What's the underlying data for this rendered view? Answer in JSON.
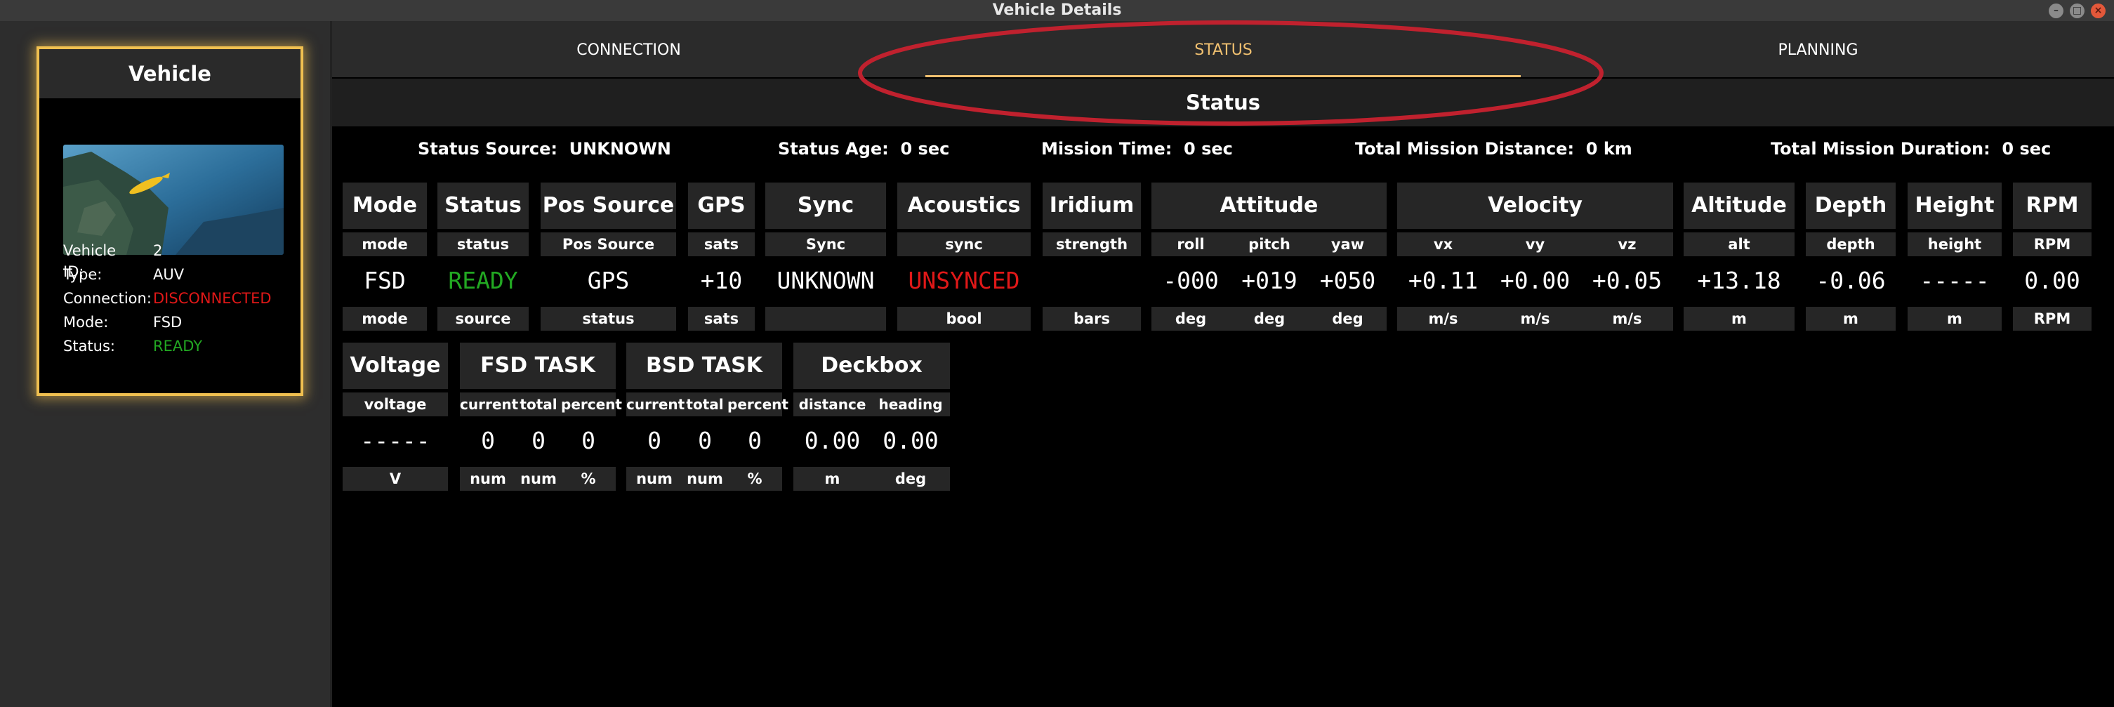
{
  "window": {
    "title": "Vehicle Details"
  },
  "vehicle_card": {
    "title": "Vehicle",
    "fields": [
      {
        "label": "Vehicle ID:",
        "value": "2"
      },
      {
        "label": "Type:",
        "value": "AUV"
      },
      {
        "label": "Connection:",
        "value": "DISCONNECTED"
      },
      {
        "label": "Mode:",
        "value": "FSD"
      },
      {
        "label": "Status:",
        "value": "READY"
      }
    ]
  },
  "tabs": [
    {
      "label": "CONNECTION"
    },
    {
      "label": "STATUS",
      "selected": true
    },
    {
      "label": "PLANNING"
    }
  ],
  "section_title": "Status",
  "info": {
    "status_source": {
      "label": "Status Source:",
      "value": "UNKNOWN"
    },
    "status_age": {
      "label": "Status Age:",
      "value": "0 sec"
    },
    "mission_time": {
      "label": "Mission Time:",
      "value": "0 sec"
    },
    "total_distance": {
      "label": "Total Mission Distance:",
      "value": "0 km"
    },
    "total_duration": {
      "label": "Total Mission Duration:",
      "value": "0 sec"
    }
  },
  "groups_row1": [
    {
      "title": "Mode",
      "cols": [
        {
          "label": "mode",
          "value": "FSD",
          "unit": "mode"
        }
      ]
    },
    {
      "title": "Status",
      "cols": [
        {
          "label": "status",
          "value": "READY",
          "unit": "source"
        }
      ]
    },
    {
      "title": "Pos Source",
      "cols": [
        {
          "label": "Pos Source",
          "value": "GPS",
          "unit": "status"
        }
      ]
    },
    {
      "title": "GPS",
      "cols": [
        {
          "label": "sats",
          "value": "+10",
          "unit": "sats"
        }
      ]
    },
    {
      "title": "Sync",
      "cols": [
        {
          "label": "Sync",
          "value": "UNKNOWN",
          "unit": ""
        }
      ]
    },
    {
      "title": "Acoustics",
      "cols": [
        {
          "label": "sync",
          "value": "UNSYNCED",
          "unit": "bool"
        }
      ]
    },
    {
      "title": "Iridium",
      "cols": [
        {
          "label": "strength",
          "value": "",
          "unit": "bars"
        }
      ]
    },
    {
      "title": "Attitude",
      "cols": [
        {
          "label": "roll",
          "value": "-000",
          "unit": "deg"
        },
        {
          "label": "pitch",
          "value": "+019",
          "unit": "deg"
        },
        {
          "label": "yaw",
          "value": "+050",
          "unit": "deg"
        }
      ]
    },
    {
      "title": "Velocity",
      "cols": [
        {
          "label": "vx",
          "value": "+0.11",
          "unit": "m/s"
        },
        {
          "label": "vy",
          "value": "+0.00",
          "unit": "m/s"
        },
        {
          "label": "vz",
          "value": "+0.05",
          "unit": "m/s"
        }
      ]
    },
    {
      "title": "Altitude",
      "cols": [
        {
          "label": "alt",
          "value": "+13.18",
          "unit": "m"
        }
      ]
    },
    {
      "title": "Depth",
      "cols": [
        {
          "label": "depth",
          "value": "-0.06",
          "unit": "m"
        }
      ]
    },
    {
      "title": "Height",
      "cols": [
        {
          "label": "height",
          "value": "-----",
          "unit": "m"
        }
      ]
    },
    {
      "title": "RPM",
      "cols": [
        {
          "label": "RPM",
          "value": "0.00",
          "unit": "RPM"
        }
      ]
    }
  ],
  "groups_row2": [
    {
      "title": "Voltage",
      "cols": [
        {
          "label": "voltage",
          "value": "-----",
          "unit": "V"
        }
      ]
    },
    {
      "title": "FSD TASK",
      "cols": [
        {
          "label": "current",
          "value": "0",
          "unit": "num"
        },
        {
          "label": "total",
          "value": "0",
          "unit": "num"
        },
        {
          "label": "percent",
          "value": "0",
          "unit": "%"
        }
      ]
    },
    {
      "title": "BSD TASK",
      "cols": [
        {
          "label": "current",
          "value": "0",
          "unit": "num"
        },
        {
          "label": "total",
          "value": "0",
          "unit": "num"
        },
        {
          "label": "percent",
          "value": "0",
          "unit": "%"
        }
      ]
    },
    {
      "title": "Deckbox",
      "cols": [
        {
          "label": "distance",
          "value": "0.00",
          "unit": "m"
        },
        {
          "label": "heading",
          "value": "0.00",
          "unit": "deg"
        }
      ]
    }
  ],
  "colors": {
    "accent": "#f0c070",
    "ready": "#22a822",
    "error": "#e01818",
    "card_border": "#f0c050",
    "annotation": "#c0212e"
  },
  "icons": [
    "minimize-icon",
    "maximize-icon",
    "close-icon"
  ]
}
